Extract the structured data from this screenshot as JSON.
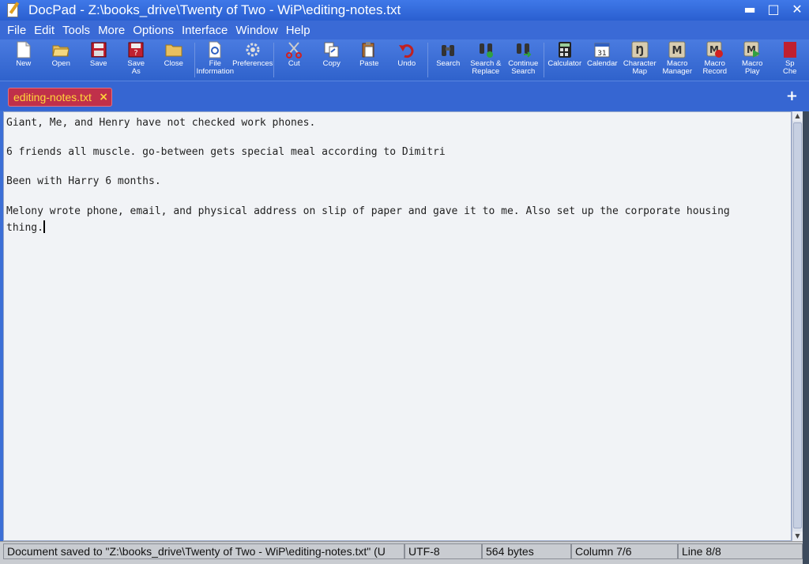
{
  "window": {
    "title": "DocPad - Z:\\books_drive\\Twenty of Two - WiP\\editing-notes.txt",
    "controls": {
      "minimize": "▬",
      "maximize": "□",
      "close": "✕"
    }
  },
  "menu": [
    {
      "label": "File"
    },
    {
      "label": "Edit"
    },
    {
      "label": "Tools"
    },
    {
      "label": "More"
    },
    {
      "label": "Options"
    },
    {
      "label": "Interface"
    },
    {
      "label": "Window"
    },
    {
      "label": "Help"
    }
  ],
  "toolbar": [
    {
      "label": "New",
      "icon": "new-file-icon"
    },
    {
      "label": "Open",
      "icon": "open-folder-icon"
    },
    {
      "label": "Save",
      "icon": "save-icon"
    },
    {
      "label": "Save As",
      "icon": "save-as-icon"
    },
    {
      "label": "Close",
      "icon": "close-folder-icon"
    },
    {
      "label": "File Information",
      "icon": "file-info-icon"
    },
    {
      "label": "Preferences",
      "icon": "gear-icon"
    },
    {
      "label": "Cut",
      "icon": "scissors-icon"
    },
    {
      "label": "Copy",
      "icon": "copy-icon"
    },
    {
      "label": "Paste",
      "icon": "paste-icon"
    },
    {
      "label": "Undo",
      "icon": "undo-icon"
    },
    {
      "label": "Search",
      "icon": "binoculars-icon"
    },
    {
      "label": "Search & Replace",
      "icon": "search-replace-icon"
    },
    {
      "label": "Continue Search",
      "icon": "continue-search-icon"
    },
    {
      "label": "Calculator",
      "icon": "calculator-icon"
    },
    {
      "label": "Calendar",
      "icon": "calendar-icon"
    },
    {
      "label": "Character Map",
      "icon": "character-map-icon"
    },
    {
      "label": "Macro Manager",
      "icon": "macro-manager-icon"
    },
    {
      "label": "Macro Record",
      "icon": "macro-record-icon"
    },
    {
      "label": "Macro Play",
      "icon": "macro-play-icon"
    },
    {
      "label": "Sp Che",
      "icon": "spell-check-icon"
    }
  ],
  "tab": {
    "label": "editing-notes.txt",
    "close": "×"
  },
  "tab_add": "+",
  "editor": {
    "lines": [
      "Giant, Me, and Henry have not checked work phones.",
      "6 friends all muscle. go-between gets special meal according to Dimitri",
      "Been with Harry 6 months.",
      "Melony wrote phone, email, and physical address on slip of paper and gave it to me. Also set up the corporate housing",
      "thing."
    ]
  },
  "status": {
    "message": "Document saved to \"Z:\\books_drive\\Twenty of Two - WiP\\editing-notes.txt\"   (U",
    "encoding": "UTF-8",
    "size": "564 bytes",
    "column": "Column 7/6",
    "line": "Line 8/8"
  },
  "colors": {
    "titlebar": "#2a5fd0",
    "tab_bg": "#c0304a",
    "tab_text": "#ffd63a",
    "editor_bg": "#f1f3f6"
  }
}
